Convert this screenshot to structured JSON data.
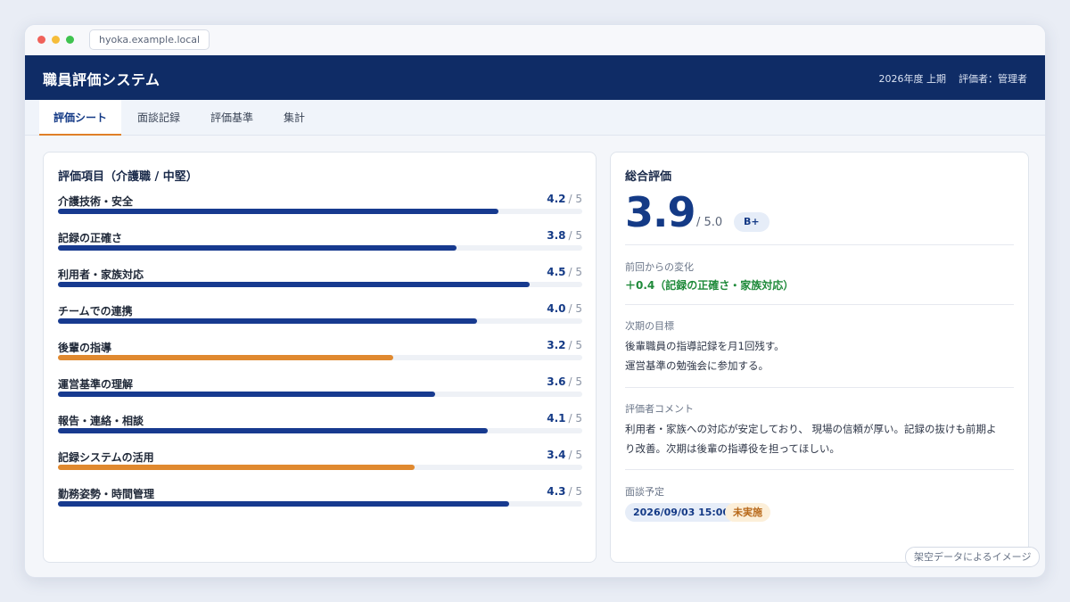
{
  "browser": {
    "url": "hyoka.example.local"
  },
  "app": {
    "title": "職員評価システム",
    "period": "2026年度 上期",
    "evaluator": "評価者：管理者"
  },
  "tabs": [
    {
      "label": "評価シート",
      "active": true
    },
    {
      "label": "面談記録",
      "active": false
    },
    {
      "label": "評価基準",
      "active": false
    },
    {
      "label": "集計",
      "active": false
    }
  ],
  "items_card": {
    "title": "評価項目（介護職 / 中堅）",
    "max_label": "/ 5",
    "max": 5,
    "items": [
      {
        "label": "介護技術・安全",
        "score": "4.2",
        "level": 0.84,
        "color": "#173a8f"
      },
      {
        "label": "記録の正確さ",
        "score": "3.8",
        "level": 0.76,
        "color": "#173a8f"
      },
      {
        "label": "利用者・家族対応",
        "score": "4.5",
        "level": 0.9,
        "color": "#173a8f"
      },
      {
        "label": "チームでの連携",
        "score": "4.0",
        "level": 0.8,
        "color": "#173a8f"
      },
      {
        "label": "後輩の指導",
        "score": "3.2",
        "level": 0.64,
        "color": "#e0892f"
      },
      {
        "label": "運営基準の理解",
        "score": "3.6",
        "level": 0.72,
        "color": "#173a8f"
      },
      {
        "label": "報告・連絡・相談",
        "score": "4.1",
        "level": 0.82,
        "color": "#173a8f"
      },
      {
        "label": "記録システムの活用",
        "score": "3.4",
        "level": 0.68,
        "color": "#e0892f"
      },
      {
        "label": "勤務姿勢・時間管理",
        "score": "4.3",
        "level": 0.86,
        "color": "#173a8f"
      }
    ]
  },
  "summary": {
    "title": "総合評価",
    "score": "3.9",
    "max": "/ 5.0",
    "grade": "B+",
    "change_label": "前回からの変化",
    "change_value": "＋0.4（記録の正確さ・家族対応）",
    "goal_label": "次期の目標",
    "goal_line1": "後輩職員の指導記録を月1回残す。",
    "goal_line2": "運営基準の勉強会に参加する。",
    "comment_label": "評価者コメント",
    "comment_line1": "利用者・家族への対応が安定しており、 現場の信頼が厚い。記録の抜けも前期よ",
    "comment_line2": "り改善。次期は後輩の指導役を担ってほしい。",
    "interview_label": "面談予定",
    "interview_date": "2026/09/03 15:00",
    "interview_status": "未実施"
  },
  "watermark": "架空データによるイメージ"
}
